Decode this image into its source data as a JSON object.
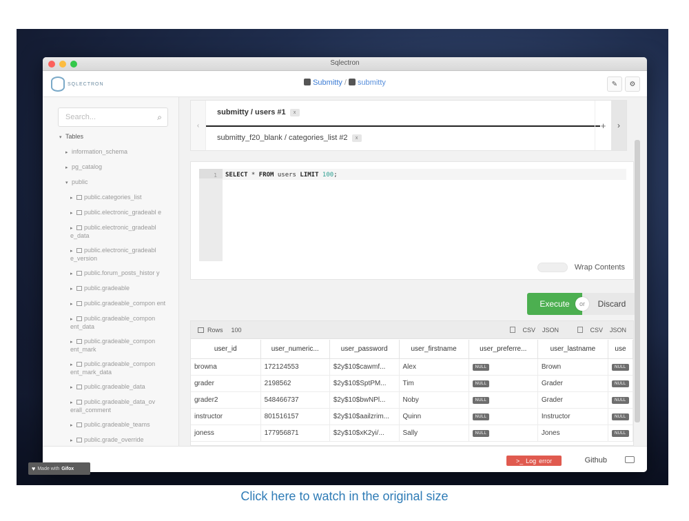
{
  "window": {
    "title": "Sqlectron"
  },
  "brand": {
    "name": "SQLECTRON"
  },
  "breadcrumb": {
    "server": "Submitty",
    "separator": "/",
    "database": "submitty"
  },
  "header": {
    "pin_icon": "pin-icon",
    "settings_icon": "gear-icon"
  },
  "sidebar": {
    "search_placeholder": "Search...",
    "tree": [
      {
        "label": "Tables",
        "arrow": "▾",
        "level": 0,
        "table": false
      },
      {
        "label": "information_schema",
        "arrow": "▸",
        "level": 1,
        "table": false
      },
      {
        "label": "pg_catalog",
        "arrow": "▸",
        "level": 1,
        "table": false
      },
      {
        "label": "public",
        "arrow": "▾",
        "level": 1,
        "table": false
      },
      {
        "label": "public.categories_list",
        "arrow": "▸",
        "level": 2,
        "table": true
      },
      {
        "label": "public.electronic_gradeabl e",
        "arrow": "▸",
        "level": 2,
        "table": true
      },
      {
        "label": "public.electronic_gradeabl e_data",
        "arrow": "▸",
        "level": 2,
        "table": true
      },
      {
        "label": "public.electronic_gradeabl e_version",
        "arrow": "▸",
        "level": 2,
        "table": true
      },
      {
        "label": "public.forum_posts_histor y",
        "arrow": "▸",
        "level": 2,
        "table": true
      },
      {
        "label": "public.gradeable",
        "arrow": "▸",
        "level": 2,
        "table": true
      },
      {
        "label": "public.gradeable_compon ent",
        "arrow": "▸",
        "level": 2,
        "table": true
      },
      {
        "label": "public.gradeable_compon ent_data",
        "arrow": "▸",
        "level": 2,
        "table": true
      },
      {
        "label": "public.gradeable_compon ent_mark",
        "arrow": "▸",
        "level": 2,
        "table": true
      },
      {
        "label": "public.gradeable_compon ent_mark_data",
        "arrow": "▸",
        "level": 2,
        "table": true
      },
      {
        "label": "public.gradeable_data",
        "arrow": "▸",
        "level": 2,
        "table": true
      },
      {
        "label": "public.gradeable_data_ov erall_comment",
        "arrow": "▸",
        "level": 2,
        "table": true
      },
      {
        "label": "public.gradeable_teams",
        "arrow": "▸",
        "level": 2,
        "table": true
      },
      {
        "label": "public.grade_override",
        "arrow": "▸",
        "level": 2,
        "table": true
      }
    ]
  },
  "tabs": {
    "prev": "‹",
    "next": "›",
    "add": "+",
    "close": "x",
    "items": [
      {
        "label": "submitty / users #1"
      },
      {
        "label": "submitty_f20_blank / categories_list #2"
      }
    ]
  },
  "editor": {
    "line_number": "1",
    "kw1": "SELECT",
    "star": " * ",
    "kw2": "FROM",
    "table": " users ",
    "kw3": "LIMIT",
    "num": " 100",
    "semi": ";",
    "wrap_label": "Wrap Contents"
  },
  "actions": {
    "execute": "Execute",
    "or": "or",
    "discard": "Discard"
  },
  "results": {
    "rows_label": "Rows",
    "rows_count": "100",
    "export_formats": [
      "CSV",
      "JSON"
    ],
    "columns": [
      "user_id",
      "user_numeric...",
      "user_password",
      "user_firstname",
      "user_preferre...",
      "user_lastname",
      "use"
    ],
    "null_label": "NULL",
    "rows": [
      {
        "user_id": "browna",
        "numeric": "172124553",
        "password": "$2y$10$cawmf...",
        "firstname": "Alex",
        "lastname": "Brown"
      },
      {
        "user_id": "grader",
        "numeric": "2198562",
        "password": "$2y$10$SptPM...",
        "firstname": "Tim",
        "lastname": "Grader"
      },
      {
        "user_id": "grader2",
        "numeric": "548466737",
        "password": "$2y$10$bwNPl...",
        "firstname": "Noby",
        "lastname": "Grader"
      },
      {
        "user_id": "instructor",
        "numeric": "801516157",
        "password": "$2y$10$aailzrim...",
        "firstname": "Quinn",
        "lastname": "Instructor"
      },
      {
        "user_id": "joness",
        "numeric": "177956871",
        "password": "$2y$10$xK2yi/...",
        "firstname": "Sally",
        "lastname": "Jones"
      }
    ]
  },
  "footer": {
    "log_label": "Log",
    "log_error": "error",
    "github": "Github"
  },
  "watermark": {
    "prefix": "Made with",
    "brand": "Gifox"
  },
  "caption": "Click here to watch in the original size"
}
